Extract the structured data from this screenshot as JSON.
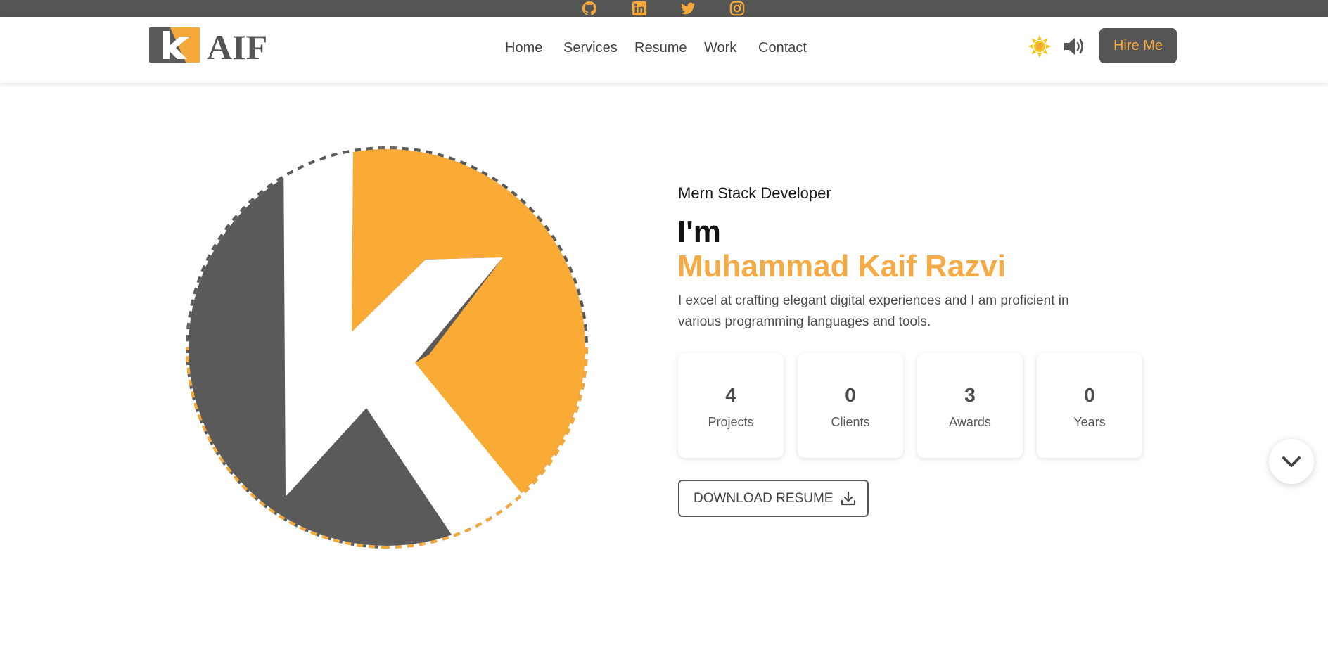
{
  "social": {
    "github_icon": "github-icon",
    "linkedin_icon": "linkedin-icon",
    "twitter_icon": "twitter-icon",
    "instagram_icon": "instagram-icon",
    "icon_color": "#f5a93a"
  },
  "header": {
    "logo_text": "AIF",
    "logo_letter": "k",
    "nav": [
      "Home",
      "Services",
      "Resume",
      "Work",
      "Contact"
    ],
    "hire_label": "Hire Me"
  },
  "hero": {
    "role": "Mern Stack Developer",
    "greeting": "I'm",
    "name": "Muhammad Kaif Razvi",
    "description": "I excel at crafting elegant digital experiences and I am proficient in various programming languages and tools.",
    "stats": [
      {
        "value": "4",
        "label": "Projects"
      },
      {
        "value": "0",
        "label": "Clients"
      },
      {
        "value": "3",
        "label": "Awards"
      },
      {
        "value": "0",
        "label": "Years"
      }
    ],
    "download_label": "DOWNLOAD RESUME"
  },
  "colors": {
    "accent": "#f5a93a",
    "dark": "#555555"
  }
}
